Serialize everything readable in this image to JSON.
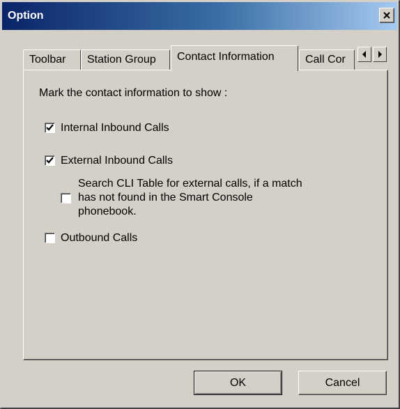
{
  "window": {
    "title": "Option"
  },
  "tabs": [
    {
      "label": "Toolbar",
      "active": false
    },
    {
      "label": "Station Group",
      "active": false
    },
    {
      "label": "Contact Information",
      "active": true
    },
    {
      "label": "Call Cor",
      "active": false
    }
  ],
  "tab_scroll": {
    "left_icon": "arrow-left-icon",
    "right_icon": "arrow-right-icon"
  },
  "panel": {
    "prompt": "Mark the contact information to show :",
    "options": [
      {
        "label": "Internal Inbound Calls",
        "checked": true
      },
      {
        "label": "External Inbound Calls",
        "checked": true
      },
      {
        "label_lines": [
          "Search CLI Table for external calls, if a match",
          "has not found in the Smart Console",
          "phonebook."
        ],
        "checked": false
      },
      {
        "label": "Outbound Calls",
        "checked": false
      }
    ]
  },
  "buttons": {
    "ok": "OK",
    "cancel": "Cancel"
  },
  "colors": {
    "title_start": "#0a246a",
    "title_end": "#a6caf0",
    "face": "#d4d0c8"
  }
}
